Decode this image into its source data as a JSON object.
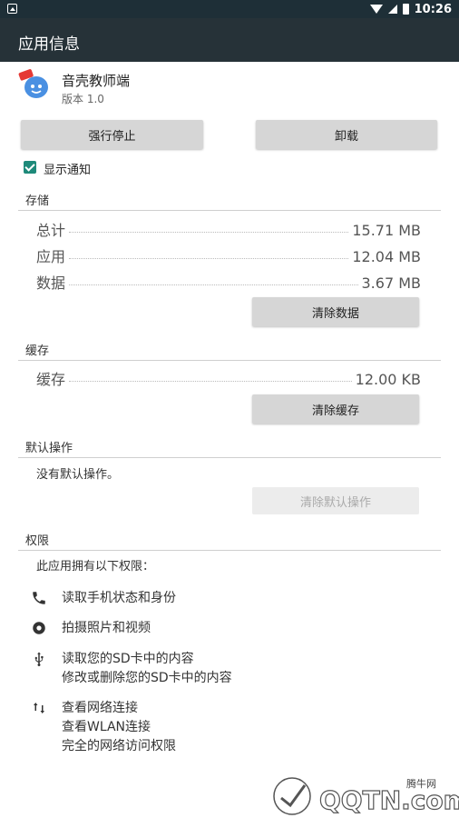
{
  "status": {
    "time": "10:26"
  },
  "appbar": {
    "title": "应用信息"
  },
  "app": {
    "name": "音壳教师端",
    "version": "版本 1.0",
    "badge_color": "#e53935",
    "icon_color": "#4a90e2"
  },
  "buttons": {
    "force_stop": "强行停止",
    "uninstall": "卸载",
    "clear_data": "清除数据",
    "clear_cache": "清除缓存",
    "clear_defaults": "清除默认操作"
  },
  "notifications": {
    "label": "显示通知",
    "checked": true
  },
  "storage": {
    "header": "存储",
    "rows": [
      {
        "label": "总计",
        "value": "15.71 MB"
      },
      {
        "label": "应用",
        "value": "12.04 MB"
      },
      {
        "label": "数据",
        "value": "3.67 MB"
      }
    ]
  },
  "cache": {
    "header": "缓存",
    "rows": [
      {
        "label": "缓存",
        "value": "12.00 KB"
      }
    ]
  },
  "defaults": {
    "header": "默认操作",
    "text": "没有默认操作。"
  },
  "permissions": {
    "header": "权限",
    "intro": "此应用拥有以下权限：",
    "items": [
      {
        "icon": "phone-icon",
        "lines": [
          "读取手机状态和身份"
        ]
      },
      {
        "icon": "camera-icon",
        "lines": [
          "拍摄照片和视频"
        ]
      },
      {
        "icon": "usb-icon",
        "lines": [
          "读取您的SD卡中的内容",
          "修改或删除您的SD卡中的内容"
        ]
      },
      {
        "icon": "network-arrows-icon",
        "lines": [
          "查看网络连接",
          "查看WLAN连接",
          "完全的网络访问权限"
        ]
      }
    ]
  },
  "watermark": {
    "text": "腾牛网",
    "logo": "QQTN.com"
  },
  "colors": {
    "statusbar": "#1e2f37",
    "appbar": "#263238",
    "checkbox": "#1e8a7a"
  }
}
